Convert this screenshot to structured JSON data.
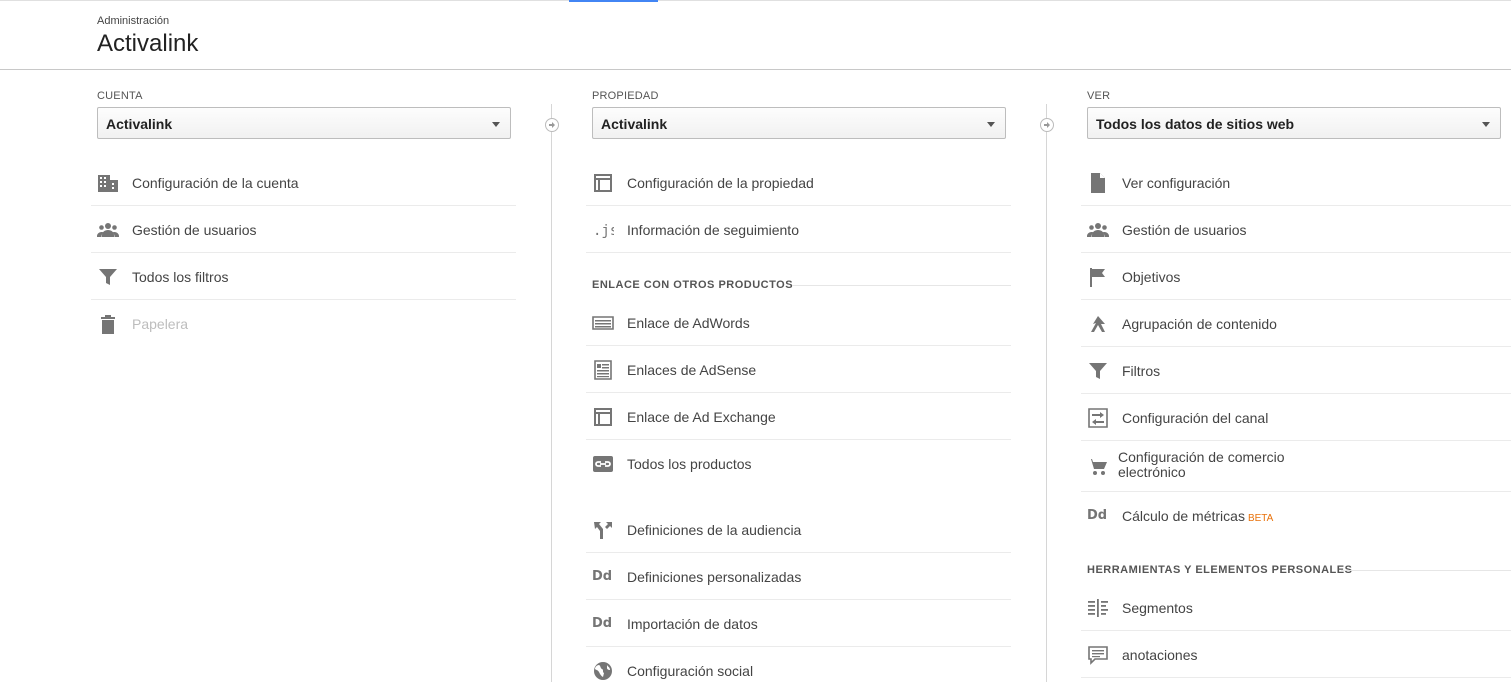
{
  "header": {
    "breadcrumb": "Administración",
    "title": "Activalink"
  },
  "account": {
    "label": "CUENTA",
    "selected": "Activalink",
    "items": [
      {
        "label": "Configuración de la cuenta",
        "icon": "building-icon"
      },
      {
        "label": "Gestión de usuarios",
        "icon": "users-icon"
      },
      {
        "label": "Todos los filtros",
        "icon": "filter-icon"
      },
      {
        "label": "Papelera",
        "icon": "trash-icon",
        "disabled": true
      }
    ]
  },
  "property": {
    "label": "PROPIEDAD",
    "selected": "Activalink",
    "items": [
      {
        "label": "Configuración de la propiedad",
        "icon": "property-window-icon"
      },
      {
        "label": "Información de seguimiento",
        "icon": "js-icon"
      }
    ],
    "linking_section": "ENLACE CON OTROS PRODUCTOS",
    "linking_items": [
      {
        "label": "Enlace de AdWords",
        "icon": "adwords-icon"
      },
      {
        "label": "Enlaces de AdSense",
        "icon": "adsense-icon"
      },
      {
        "label": "Enlace de Ad Exchange",
        "icon": "ad-exchange-icon"
      },
      {
        "label": "Todos los productos",
        "icon": "link-icon"
      }
    ],
    "more_items": [
      {
        "label": "Definiciones de la audiencia",
        "icon": "audience-icon"
      },
      {
        "label": "Definiciones personalizadas",
        "icon": "dd-icon",
        "icon_text": "Dd"
      },
      {
        "label": "Importación de datos",
        "icon": "dd-icon",
        "icon_text": "Dd"
      },
      {
        "label": "Configuración social",
        "icon": "globe-icon"
      }
    ]
  },
  "view": {
    "label": "VER",
    "selected": "Todos los datos de sitios web",
    "items": [
      {
        "label": "Ver configuración",
        "icon": "document-icon"
      },
      {
        "label": "Gestión de usuarios",
        "icon": "users-icon"
      },
      {
        "label": "Objetivos",
        "icon": "flag-icon"
      },
      {
        "label": "Agrupación de contenido",
        "icon": "grouping-icon"
      },
      {
        "label": "Filtros",
        "icon": "filter-icon"
      },
      {
        "label": "Configuración del canal",
        "icon": "channel-icon"
      },
      {
        "label": "Configuración de comercio electrónico",
        "icon": "cart-icon"
      },
      {
        "label": "Cálculo de métricas",
        "badge": "BETA",
        "icon": "dd-icon",
        "icon_text": "Dd"
      }
    ],
    "tools_section": "HERRAMIENTAS Y ELEMENTOS PERSONALES",
    "tools_items": [
      {
        "label": "Segmentos",
        "icon": "segments-icon"
      },
      {
        "label": "anotaciones",
        "icon": "comment-icon"
      }
    ]
  }
}
